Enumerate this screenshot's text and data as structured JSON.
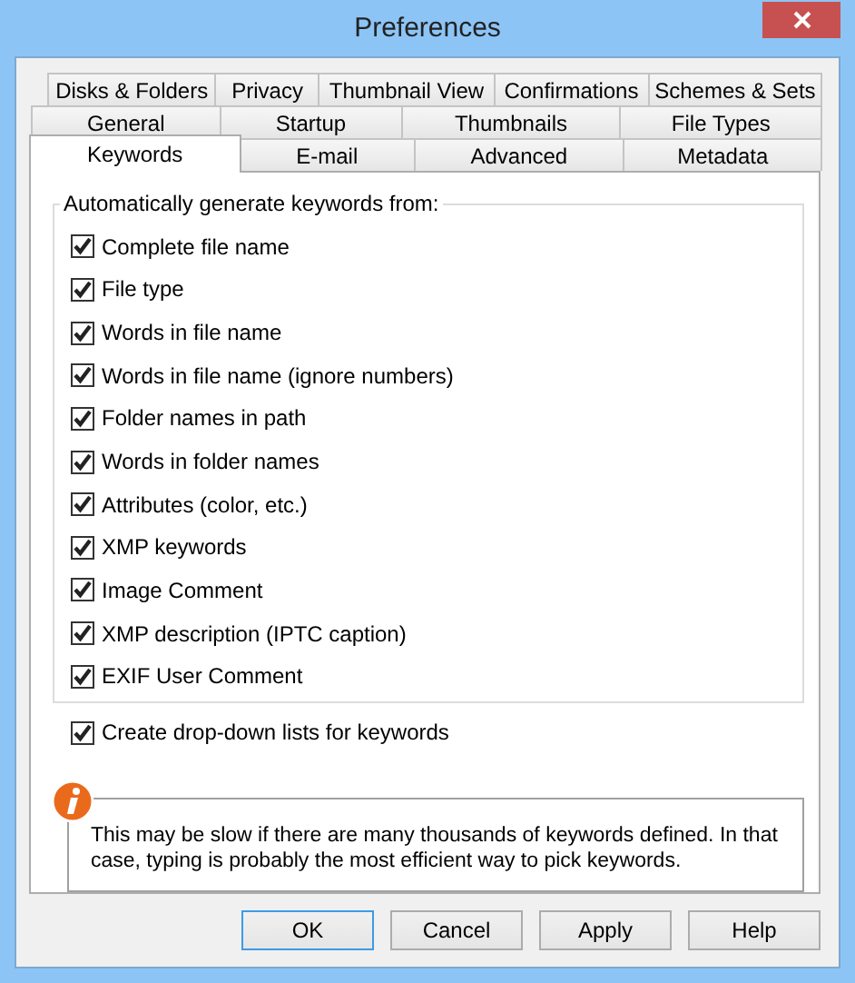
{
  "window": {
    "title": "Preferences"
  },
  "tab_rows": [
    [
      {
        "label": "Disks & Folders",
        "selected": false
      },
      {
        "label": "Privacy",
        "selected": false
      },
      {
        "label": "Thumbnail View",
        "selected": false
      },
      {
        "label": "Confirmations",
        "selected": false
      },
      {
        "label": "Schemes & Sets",
        "selected": false
      }
    ],
    [
      {
        "label": "General",
        "selected": false
      },
      {
        "label": "Startup",
        "selected": false
      },
      {
        "label": "Thumbnails",
        "selected": false
      },
      {
        "label": "File Types",
        "selected": false
      }
    ],
    [
      {
        "label": "Keywords",
        "selected": true
      },
      {
        "label": "E-mail",
        "selected": false
      },
      {
        "label": "Advanced",
        "selected": false
      },
      {
        "label": "Metadata",
        "selected": false
      }
    ]
  ],
  "group": {
    "title": "Automatically generate keywords from:",
    "options": [
      {
        "label": "Complete file name",
        "checked": true
      },
      {
        "label": "File type",
        "checked": true
      },
      {
        "label": "Words in file name",
        "checked": true
      },
      {
        "label": "Words in file name (ignore numbers)",
        "checked": true
      },
      {
        "label": "Folder names in path",
        "checked": true
      },
      {
        "label": "Words in folder names",
        "checked": true
      },
      {
        "label": "Attributes (color, etc.)",
        "checked": true
      },
      {
        "label": "XMP keywords",
        "checked": true
      },
      {
        "label": "Image Comment",
        "checked": true
      },
      {
        "label": "XMP description (IPTC caption)",
        "checked": true
      },
      {
        "label": "EXIF User Comment",
        "checked": true
      }
    ]
  },
  "dropdown_option": {
    "label": "Create drop-down lists for keywords",
    "checked": true
  },
  "info": "This may be slow if there are many thousands of keywords defined. In that case, typing is probably the most efficient way to pick keywords.",
  "buttons": [
    {
      "label": "OK",
      "default": true
    },
    {
      "label": "Cancel",
      "default": false
    },
    {
      "label": "Apply",
      "default": false
    },
    {
      "label": "Help",
      "default": false
    }
  ]
}
